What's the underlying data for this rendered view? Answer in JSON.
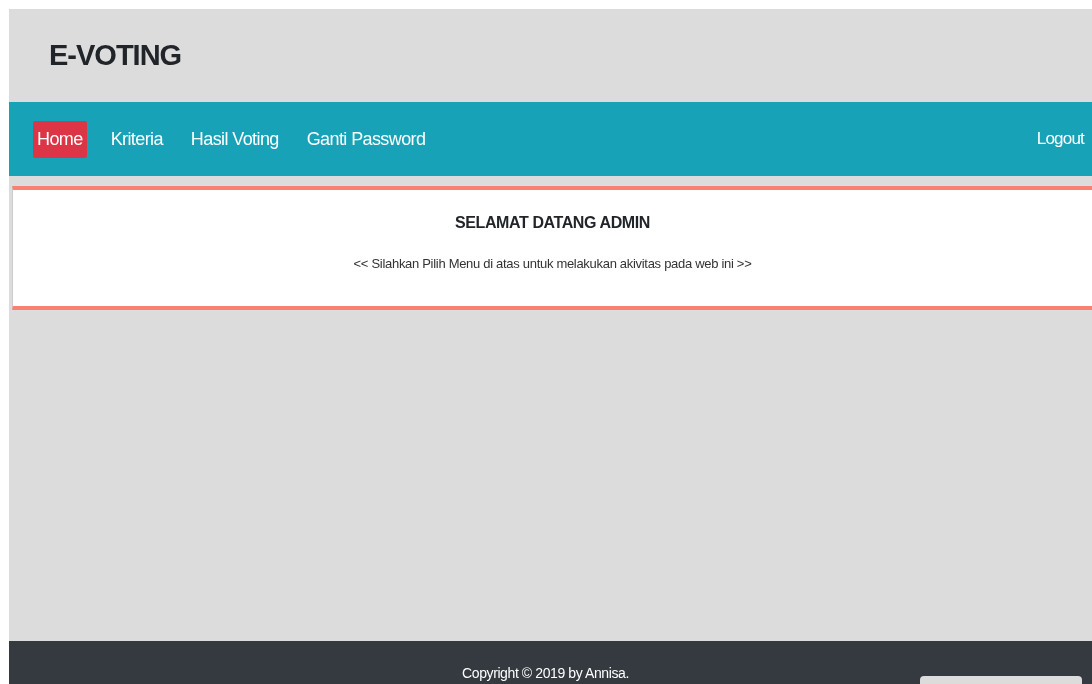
{
  "header": {
    "title": "E-VOTING"
  },
  "nav": {
    "items": [
      {
        "label": "Home",
        "selected": true
      },
      {
        "label": "Kriteria",
        "selected": false
      },
      {
        "label": "Hasil Voting",
        "selected": false
      },
      {
        "label": "Ganti Password",
        "selected": false
      }
    ],
    "logout": "Logout"
  },
  "welcome": {
    "heading": "SELAMAT DATANG ADMIN",
    "message": "<< Silahkan Pilih Menu di atas untuk melakukan akivitas pada web ini >>"
  },
  "footer": {
    "copyright": "Copyright © 2019 by Annisa."
  }
}
